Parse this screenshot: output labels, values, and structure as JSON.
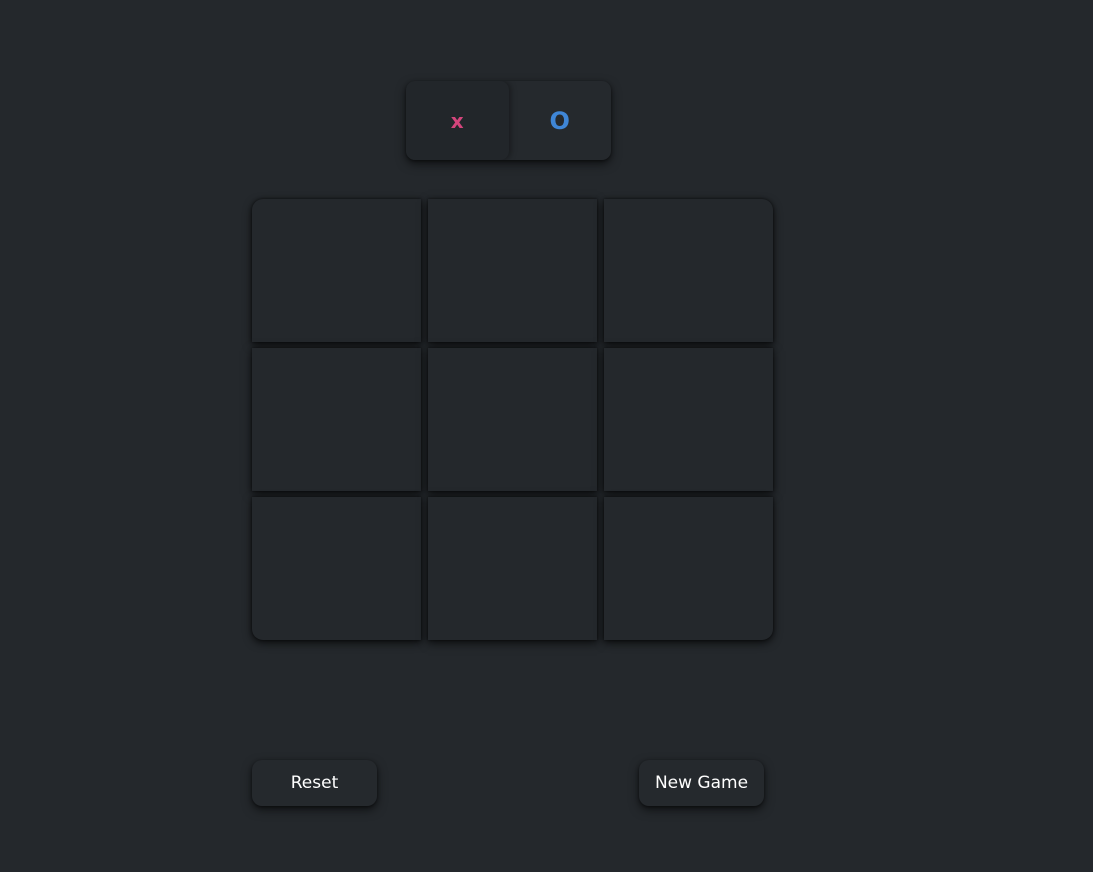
{
  "turn_selector": {
    "options": [
      {
        "symbol": "x",
        "color": "#d4457c",
        "active": true
      },
      {
        "symbol": "O",
        "color": "#3f86d6",
        "active": false
      }
    ]
  },
  "board": {
    "cells": [
      "",
      "",
      "",
      "",
      "",
      "",
      "",
      "",
      ""
    ]
  },
  "controls": {
    "reset_label": "Reset",
    "new_game_label": "New Game"
  },
  "colors": {
    "background": "#24282c",
    "x_mark": "#d4457c",
    "o_mark": "#3f86d6",
    "button_text": "#ffffff"
  }
}
